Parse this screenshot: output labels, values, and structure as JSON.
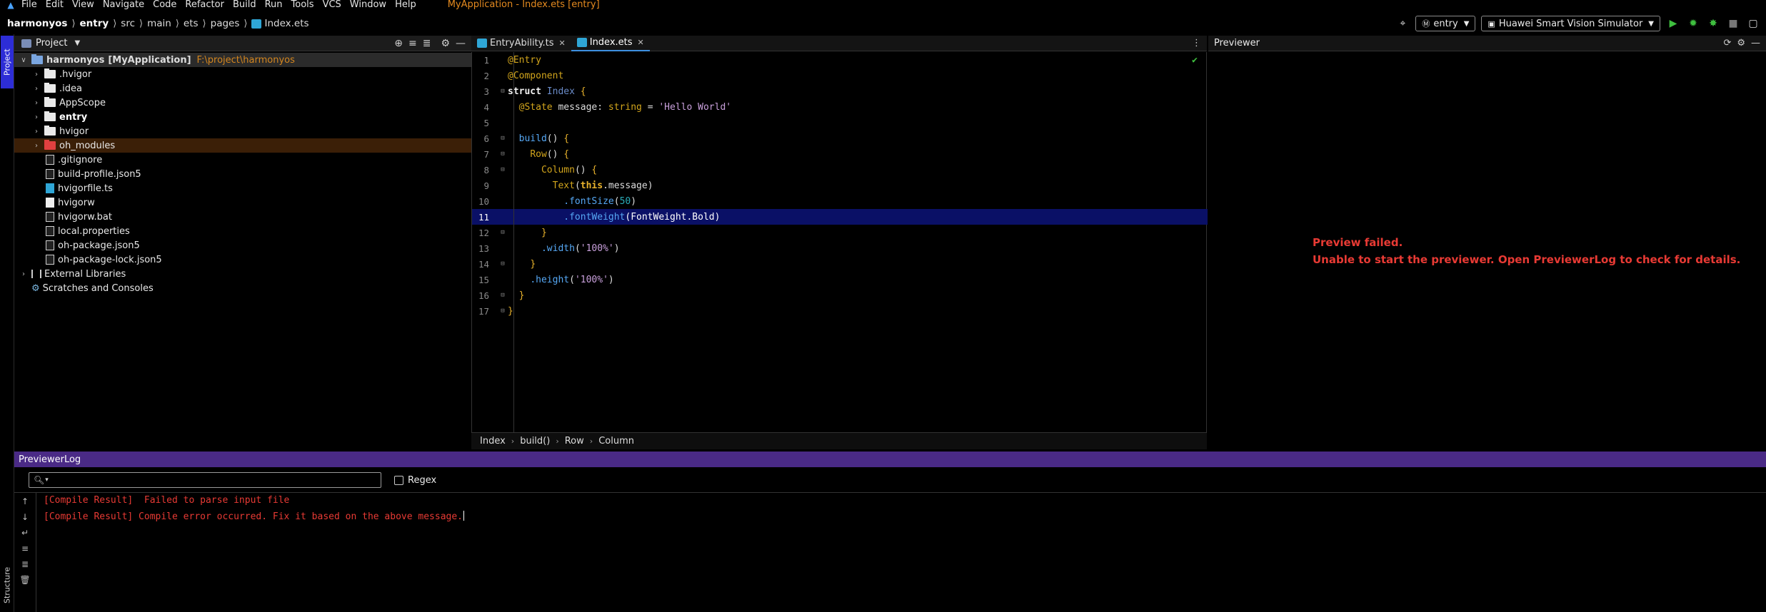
{
  "menubar": {
    "items": [
      "File",
      "Edit",
      "View",
      "Navigate",
      "Code",
      "Refactor",
      "Build",
      "Run",
      "Tools",
      "VCS",
      "Window",
      "Help"
    ],
    "window_title": "MyApplication - Index.ets [entry]"
  },
  "navbar": {
    "breadcrumbs": [
      "harmonyos",
      "entry",
      "src",
      "main",
      "ets",
      "pages",
      "Index.ets"
    ],
    "module_select": "entry",
    "device_select": "Huawei Smart Vision Simulator"
  },
  "sidebar": {
    "project_tab": "Project",
    "structure_tab": "Structure"
  },
  "project_panel": {
    "title": "Project",
    "root_name": "harmonyos",
    "root_module": "[MyApplication]",
    "root_path": "F:\\project\\harmonyos",
    "items": [
      {
        "label": ".hvigor"
      },
      {
        "label": ".idea"
      },
      {
        "label": "AppScope"
      },
      {
        "label": "entry"
      },
      {
        "label": "hvigor"
      },
      {
        "label": "oh_modules"
      },
      {
        "label": ".gitignore"
      },
      {
        "label": "build-profile.json5"
      },
      {
        "label": "hvigorfile.ts"
      },
      {
        "label": "hvigorw"
      },
      {
        "label": "hvigorw.bat"
      },
      {
        "label": "local.properties"
      },
      {
        "label": "oh-package.json5"
      },
      {
        "label": "oh-package-lock.json5"
      }
    ],
    "external_libraries": "External Libraries",
    "scratches": "Scratches and Consoles"
  },
  "editor": {
    "tabs": [
      {
        "label": "EntryAbility.ts"
      },
      {
        "label": "Index.ets"
      }
    ],
    "lines": [
      "1",
      "2",
      "3",
      "4",
      "5",
      "6",
      "7",
      "8",
      "9",
      "10",
      "11",
      "12",
      "13",
      "14",
      "15",
      "16",
      "17"
    ],
    "code": {
      "l1": "@Entry",
      "l2": "@Component",
      "l3_kw": "struct",
      "l3_name": "Index",
      "l3_brace": "{",
      "l4_ann": "@State",
      "l4_name": "message",
      "l4_colon": ":",
      "l4_type": "string",
      "l4_eq": "=",
      "l4_str": "'Hello World'",
      "l6_fn": "build",
      "l6_rest": "()",
      "l6_brace": "{",
      "l7_fn": "Row",
      "l7_rest": "()",
      "l7_brace": "{",
      "l8_fn": "Column",
      "l8_rest": "()",
      "l8_brace": "{",
      "l9_fn": "Text",
      "l9_open": "(",
      "l9_this": "this",
      "l9_prop": ".message",
      "l9_close": ")",
      "l10_fn": ".fontSize",
      "l10_open": "(",
      "l10_num": "50",
      "l10_close": ")",
      "l11_fn": ".fontWeight",
      "l11_arg": "(FontWeight.Bold)",
      "l12": "}",
      "l13_fn": ".width",
      "l13_open": "(",
      "l13_str": "'100%'",
      "l13_close": ")",
      "l14": "}",
      "l15_fn": ".height",
      "l15_open": "(",
      "l15_str": "'100%'",
      "l15_close": ")",
      "l16": "}",
      "l17": "}"
    },
    "breadcrumb": [
      "Index",
      "build()",
      "Row",
      "Column"
    ]
  },
  "previewer": {
    "title": "Previewer",
    "error_line1": "Preview failed.",
    "error_line2": "Unable to start the previewer. Open PreviewerLog to check for details."
  },
  "log_panel": {
    "title": "PreviewerLog",
    "search_placeholder": "",
    "regex_label": "Regex",
    "lines": [
      "[Compile Result]  Failed to parse input file",
      "[Compile Result] Compile error occurred. Fix it based on the above message."
    ]
  },
  "colors": {
    "accent": "#2d2dd6",
    "error": "#e83a34",
    "log_header": "#4a2a86",
    "current_line": "#0a1066"
  }
}
